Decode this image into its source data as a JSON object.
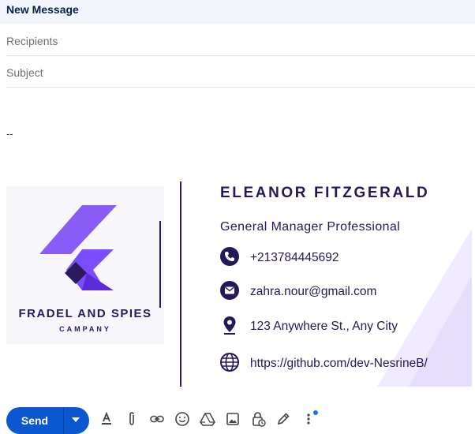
{
  "compose": {
    "title": "New Message",
    "recipients_placeholder": "Recipients",
    "subject_placeholder": "Subject",
    "separator": "--"
  },
  "signature": {
    "company_line1": "FRADEL AND SPIES",
    "company_line2": "CAMPANY",
    "name": "ELEANOR FITZGERALD",
    "role": "General Manager Professional",
    "contacts": [
      {
        "icon": "phone-icon",
        "value": "+213784445692"
      },
      {
        "icon": "email-icon",
        "value": "zahra.nour@gmail.com"
      },
      {
        "icon": "location-pin-icon",
        "value": "123 Anywhere St., Any City"
      },
      {
        "icon": "globe-icon",
        "value": "https://github.com/dev-NesrineB/"
      }
    ],
    "colors": {
      "primary": "#22195a",
      "accent": "#7c4dff"
    }
  },
  "toolbar": {
    "send_label": "Send",
    "icons": [
      "text-format-icon",
      "attach-icon",
      "link-icon",
      "emoji-icon",
      "drive-icon",
      "image-icon",
      "lock-clock-icon",
      "pen-icon",
      "more-vert-icon"
    ],
    "send_color": "#0b57d0"
  }
}
